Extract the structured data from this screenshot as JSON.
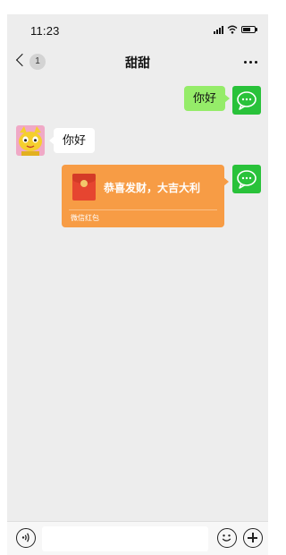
{
  "status_bar": {
    "time": "11:23"
  },
  "nav": {
    "back_badge": "1",
    "title": "甜甜"
  },
  "messages": [
    {
      "direction": "outgoing",
      "text": "你好"
    },
    {
      "direction": "incoming",
      "text": "你好"
    },
    {
      "direction": "outgoing",
      "type": "red_packet",
      "title": "恭喜发财，大吉大利",
      "label": "微信红包"
    }
  ],
  "input": {
    "placeholder": ""
  },
  "icons": {
    "back": "chevron-left-icon",
    "more": "more-dots-icon",
    "signal": "signal-bars-icon",
    "wifi": "wifi-icon",
    "battery": "battery-icon",
    "voice": "voice-icon",
    "emoji": "emoji-icon",
    "plus": "plus-icon",
    "avatar_self": "wechat-bubble-icon",
    "avatar_other": "cartoon-cat-avatar"
  },
  "colors": {
    "background": "#ededed",
    "outgoing_bubble": "#95ec69",
    "incoming_bubble": "#ffffff",
    "red_packet": "#f79c45",
    "avatar_green": "#29c23a"
  }
}
